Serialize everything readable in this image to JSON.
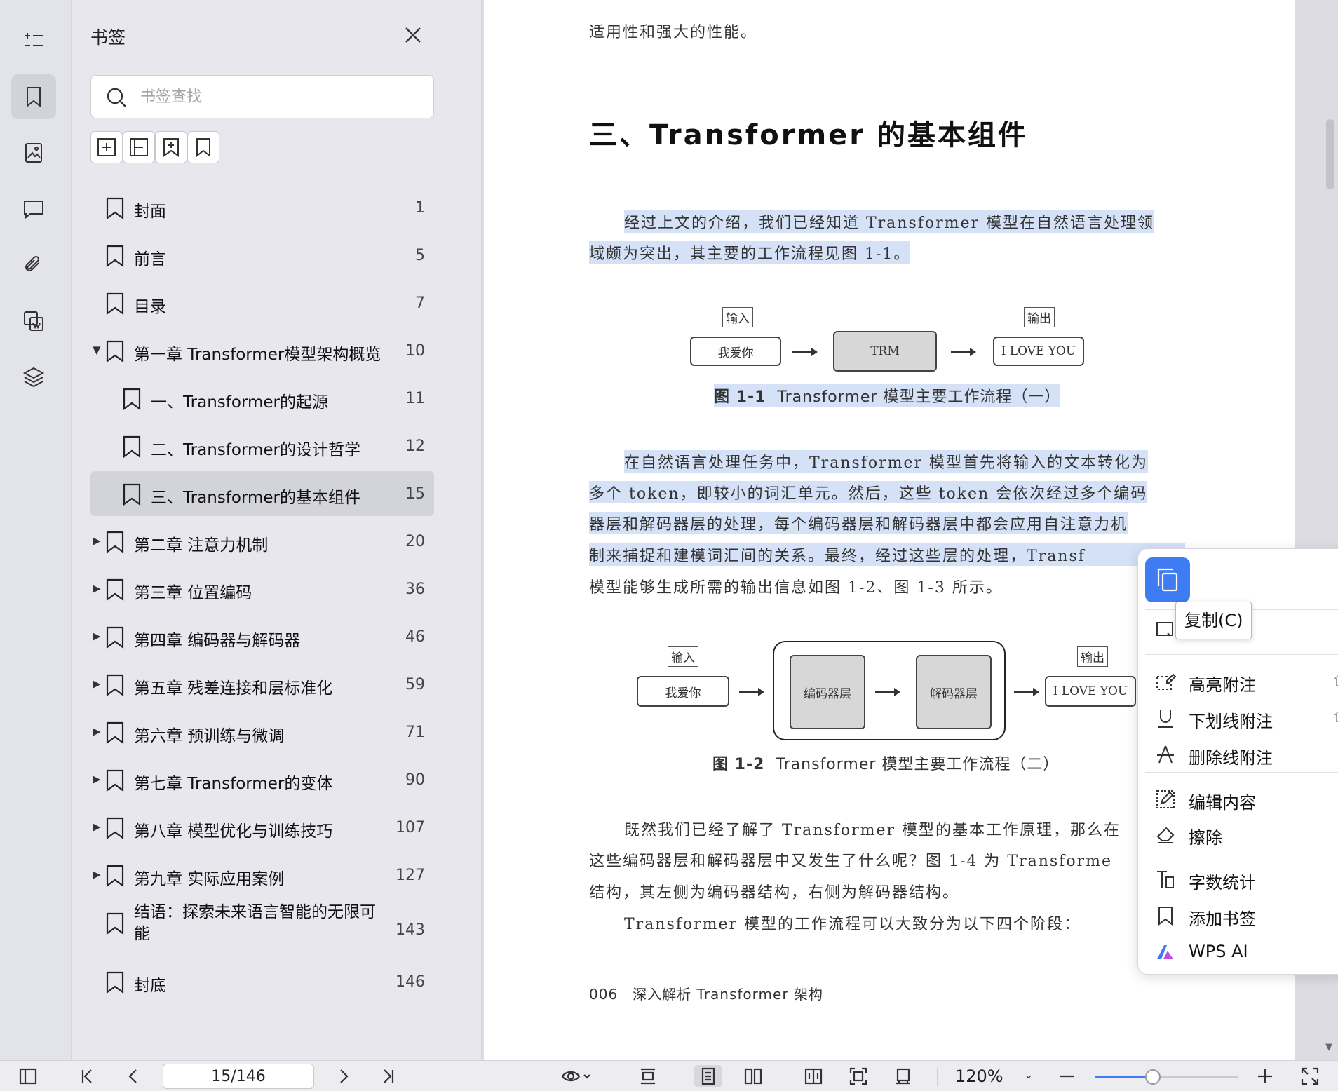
{
  "panel": {
    "title": "书签",
    "search_placeholder": "书签查找"
  },
  "bookmarks": [
    {
      "label": "封面",
      "page": "1",
      "level": 0,
      "arrow": ""
    },
    {
      "label": "前言",
      "page": "5",
      "level": 0,
      "arrow": ""
    },
    {
      "label": "目录",
      "page": "7",
      "level": 0,
      "arrow": ""
    },
    {
      "label": "第一章 Transformer模型架构概览",
      "page": "10",
      "level": 0,
      "arrow": "▼"
    },
    {
      "label": "一、Transformer的起源",
      "page": "11",
      "level": 1,
      "arrow": ""
    },
    {
      "label": "二、Transformer的设计哲学",
      "page": "12",
      "level": 1,
      "arrow": ""
    },
    {
      "label": "三、Transformer的基本组件",
      "page": "15",
      "level": 1,
      "arrow": "",
      "selected": true
    },
    {
      "label": "第二章 注意力机制",
      "page": "20",
      "level": 0,
      "arrow": "▶"
    },
    {
      "label": "第三章 位置编码",
      "page": "36",
      "level": 0,
      "arrow": "▶"
    },
    {
      "label": "第四章 编码器与解码器",
      "page": "46",
      "level": 0,
      "arrow": "▶"
    },
    {
      "label": "第五章 残差连接和层标准化",
      "page": "59",
      "level": 0,
      "arrow": "▶"
    },
    {
      "label": "第六章 预训练与微调",
      "page": "71",
      "level": 0,
      "arrow": "▶"
    },
    {
      "label": "第七章 Transformer的变体",
      "page": "90",
      "level": 0,
      "arrow": "▶"
    },
    {
      "label": "第八章 模型优化与训练技巧",
      "page": "107",
      "level": 0,
      "arrow": "▶"
    },
    {
      "label": "第九章 实际应用案例",
      "page": "127",
      "level": 0,
      "arrow": "▶"
    },
    {
      "label": "结语：探索未来语言智能的无限可能",
      "page": "143",
      "level": 0,
      "arrow": "",
      "wrap": true
    },
    {
      "label": "封底",
      "page": "146",
      "level": 0,
      "arrow": ""
    }
  ],
  "doc": {
    "line_top": "适用性和强大的性能。",
    "heading": "三、Transformer 的基本组件",
    "p1_l1": "经过上文的介绍，我们已经知道 Transformer 模型在自然语言处理领",
    "p1_l2": "域颇为突出，其主要的工作流程见图 1-1。",
    "fig1": {
      "input_label": "输入",
      "output_label": "输出",
      "input_box": "我爱你",
      "middle_box": "TRM",
      "output_box": "I LOVE YOU",
      "caption_num": "图 1-1",
      "caption_text": "Transformer 模型主要工作流程（一）"
    },
    "p2_l1": "在自然语言处理任务中，Transformer 模型首先将输入的文本转化为",
    "p2_l2": "多个 token，即较小的词汇单元。然后，这些 token 会依次经过多个编码",
    "p2_l3": "器层和解码器层的处理，每个编码器层和解码器层中都会应用自注意力机",
    "p2_l4": "制来捕捉和建模词汇间的关系。最终，经过这些层的处理，Transf",
    "p2_l5": "模型能够生成所需的输出信息如图 1-2、图 1-3 所示。",
    "fig2": {
      "input_label": "输入",
      "output_label": "输出",
      "input_box": "我爱你",
      "encoder_box": "编码器层",
      "decoder_box": "解码器层",
      "output_box": "I LOVE YOU",
      "caption_num": "图 1-2",
      "caption_text": "Transformer 模型主要工作流程（二）"
    },
    "p3_l1": "既然我们已经了解了 Transformer 模型的基本工作原理，那么在",
    "p3_l2": "这些编码器层和解码器层中又发生了什么呢？图 1-4 为 Transforme",
    "p3_l3": "结构，其左侧为编码器结构，右侧为解码器结构。",
    "p4_l1": "Transformer 模型的工作流程可以大致分为以下四个阶段：",
    "footer": "006　深入解析 Transformer 架构"
  },
  "context_menu": {
    "tooltip": "复制(C)",
    "items": [
      {
        "name": "highlight",
        "label": "高亮附注",
        "more": "⇧"
      },
      {
        "name": "underline",
        "label": "下划线附注",
        "more": "⇧"
      },
      {
        "name": "strikethrough",
        "label": "删除线附注",
        "more": ""
      },
      {
        "name": "edit-content",
        "label": "编辑内容",
        "more": ""
      },
      {
        "name": "erase",
        "label": "擦除",
        "more": ""
      },
      {
        "name": "word-count",
        "label": "字数统计",
        "more": ""
      },
      {
        "name": "add-bookmark",
        "label": "添加书签",
        "more": ""
      },
      {
        "name": "wps-ai",
        "label": "WPS AI",
        "more": ""
      }
    ]
  },
  "statusbar": {
    "page_value": "15/146",
    "zoom": "120%",
    "zoom_fraction": 0.4
  },
  "colors": {
    "accent": "#3f7cf1",
    "highlight": "#d4e1f6"
  }
}
